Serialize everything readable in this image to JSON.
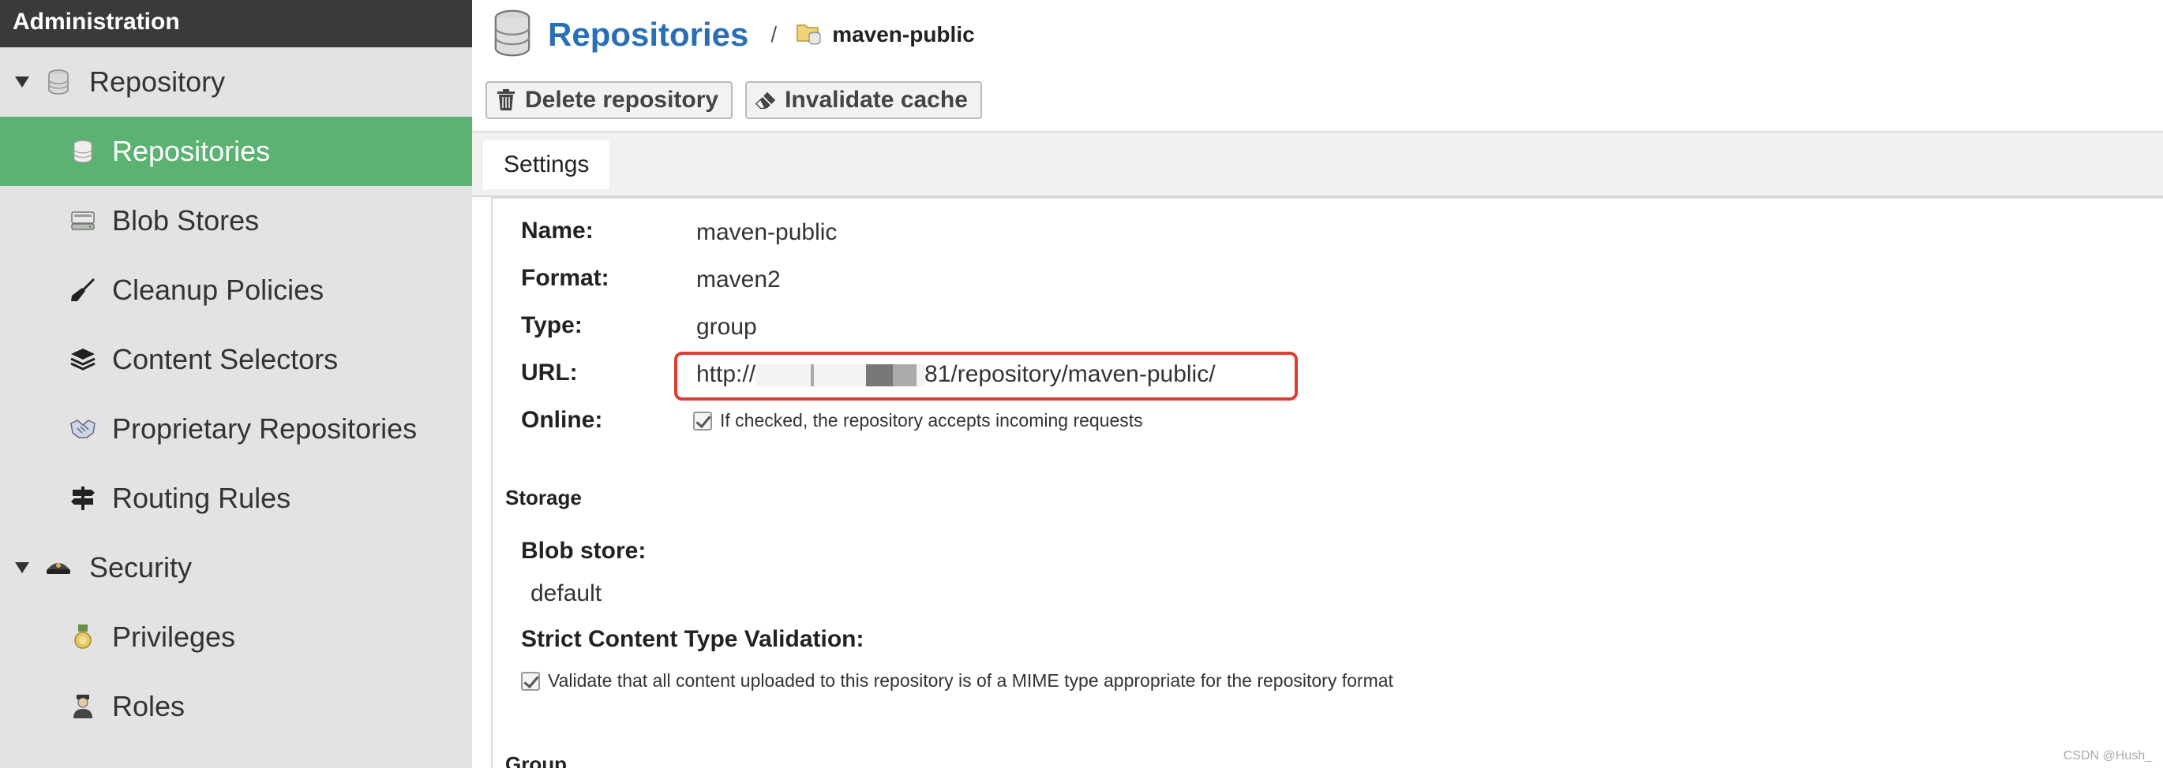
{
  "sidebar": {
    "header": "Administration",
    "groups": [
      {
        "label": "Repository",
        "icon": "database-icon"
      },
      {
        "label": "Security",
        "icon": "police-cap-icon"
      }
    ],
    "items": [
      {
        "label": "Repositories",
        "icon": "database-icon",
        "active": true
      },
      {
        "label": "Blob Stores",
        "icon": "hard-drive-icon"
      },
      {
        "label": "Cleanup Policies",
        "icon": "broom-icon"
      },
      {
        "label": "Content Selectors",
        "icon": "layers-icon"
      },
      {
        "label": "Proprietary Repositories",
        "icon": "handshake-icon"
      },
      {
        "label": "Routing Rules",
        "icon": "signpost-icon"
      },
      {
        "label": "Privileges",
        "icon": "medal-icon"
      },
      {
        "label": "Roles",
        "icon": "user-role-icon"
      }
    ]
  },
  "breadcrumb": {
    "title": "Repositories",
    "separator": "/",
    "current": "maven-public"
  },
  "toolbar": {
    "delete_label": "Delete repository",
    "invalidate_label": "Invalidate cache"
  },
  "tabs": [
    {
      "label": "Settings",
      "active": true
    }
  ],
  "settings": {
    "name_label": "Name:",
    "name_value": "maven-public",
    "format_label": "Format:",
    "format_value": "maven2",
    "type_label": "Type:",
    "type_value": "group",
    "url_label": "URL:",
    "url_prefix": "http://",
    "url_suffix": "81/repository/maven-public/",
    "online_label": "Online:",
    "online_text": "If checked, the repository accepts incoming requests",
    "online_checked": true
  },
  "storage": {
    "section_title": "Storage",
    "blob_label": "Blob store:",
    "blob_value": "default",
    "strict_label": "Strict Content Type Validation:",
    "strict_text": "Validate that all content uploaded to this repository is of a MIME type appropriate for the repository format",
    "strict_checked": true
  },
  "group_section": {
    "section_title": "Group"
  },
  "colors": {
    "accent": "#5bb272",
    "link": "#2a6fb5",
    "highlight": "#e03c31"
  },
  "watermark": "CSDN @Hush_"
}
